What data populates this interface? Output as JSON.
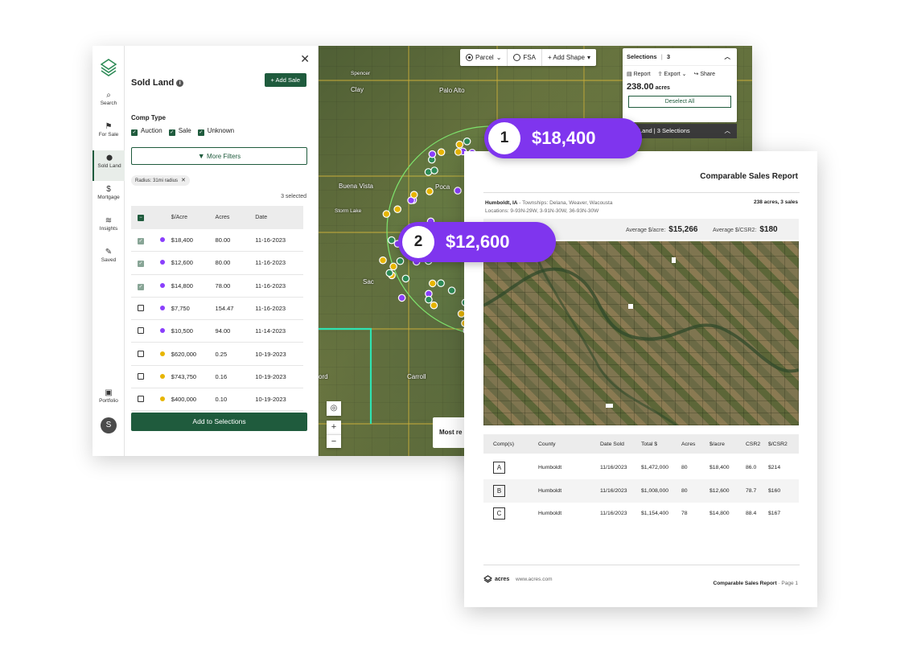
{
  "rail": {
    "items": [
      {
        "label": "Search",
        "icon": "search-icon",
        "glyph": "⌕"
      },
      {
        "label": "For Sale",
        "icon": "flag-icon",
        "glyph": "⚑"
      },
      {
        "label": "Sold Land",
        "icon": "map-pin-icon",
        "glyph": "⬤"
      },
      {
        "label": "Mortgage",
        "icon": "dollar-coin-icon",
        "glyph": "$"
      },
      {
        "label": "Insights",
        "icon": "layers-icon",
        "glyph": "≋"
      },
      {
        "label": "Saved",
        "icon": "pin-icon",
        "glyph": "✎"
      }
    ],
    "portfolio": {
      "label": "Portfolio",
      "glyph": "▣"
    },
    "avatar": "S"
  },
  "panel": {
    "title": "Sold Land",
    "add_sale": "+ Add Sale",
    "comp_type_label": "Comp Type",
    "comp_types": [
      {
        "label": "Auction",
        "checked": true
      },
      {
        "label": "Sale",
        "checked": true
      },
      {
        "label": "Unknown",
        "checked": true
      }
    ],
    "more_filters": "More Filters",
    "radius_chip": "Radius: 31mi radius",
    "selected_count": "3 selected",
    "columns": {
      "price": "$/Acre",
      "acres": "Acres",
      "date": "Date"
    },
    "rows": [
      {
        "checked": true,
        "dot": "#8a3ffc",
        "price": "$18,400",
        "acres": "80.00",
        "date": "11-16-2023"
      },
      {
        "checked": true,
        "dot": "#8a3ffc",
        "price": "$12,600",
        "acres": "80.00",
        "date": "11-16-2023"
      },
      {
        "checked": true,
        "dot": "#8a3ffc",
        "price": "$14,800",
        "acres": "78.00",
        "date": "11-16-2023"
      },
      {
        "checked": false,
        "dot": "#8a3ffc",
        "price": "$7,750",
        "acres": "154.47",
        "date": "11-16-2023"
      },
      {
        "checked": false,
        "dot": "#8a3ffc",
        "price": "$10,500",
        "acres": "94.00",
        "date": "11-14-2023"
      },
      {
        "checked": false,
        "dot": "#e7b500",
        "price": "$620,000",
        "acres": "0.25",
        "date": "10-19-2023"
      },
      {
        "checked": false,
        "dot": "#e7b500",
        "price": "$743,750",
        "acres": "0.16",
        "date": "10-19-2023"
      },
      {
        "checked": false,
        "dot": "#e7b500",
        "price": "$400,000",
        "acres": "0.10",
        "date": "10-19-2023"
      }
    ],
    "add_to_selections": "Add to Selections"
  },
  "map": {
    "toolbar": {
      "parcel": "Parcel",
      "fsa": "FSA",
      "add_shape": "+ Add Shape"
    },
    "selections": {
      "title": "Selections",
      "count": "3",
      "report": "Report",
      "export": "Export",
      "share": "Share",
      "acres_value": "238.00",
      "acres_unit": "acres",
      "deselect_all": "Deselect All",
      "sold_land_bar": "Land  |  3 Selections"
    },
    "towns": [
      {
        "name": "Spencer"
      },
      {
        "name": "Clay"
      },
      {
        "name": "Palo Alto"
      },
      {
        "name": "Buena Vista"
      },
      {
        "name": "Storm Lake"
      },
      {
        "name": "Poca"
      },
      {
        "name": "Sac"
      },
      {
        "name": "Carroll"
      },
      {
        "name": "ord"
      }
    ],
    "most_recent": "Most re",
    "zoom_in": "+",
    "zoom_out": "−"
  },
  "callouts": [
    {
      "num": "1",
      "amount": "$18,400"
    },
    {
      "num": "2",
      "amount": "$12,600"
    }
  ],
  "report": {
    "title": "Comparable Sales Report",
    "location": "Humboldt, IA",
    "townships": " - Townships: Delana, Weaver, Wacousta",
    "locations": "Locations: 9-93N-29W, 3-91N-30W, 36-93N-30W",
    "summary": "238 acres, 3 sales",
    "avg_acre_label": "Average $/acre:",
    "avg_acre_value": "$15,266",
    "avg_csr2_label": "Average $/CSR2:",
    "avg_csr2_value": "$180",
    "columns": [
      "Comp(s)",
      "County",
      "Date Sold",
      "Total $",
      "Acres",
      "$/acre",
      "CSR2",
      "$/CSR2"
    ],
    "rows": [
      {
        "comp": "A",
        "county": "Humboldt",
        "date": "11/16/2023",
        "total": "$1,472,000",
        "acres": "80",
        "per_acre": "$18,400",
        "csr2": "86.0",
        "per_csr2": "$214"
      },
      {
        "comp": "B",
        "county": "Humboldt",
        "date": "11/16/2023",
        "total": "$1,008,000",
        "acres": "80",
        "per_acre": "$12,600",
        "csr2": "78.7",
        "per_csr2": "$160"
      },
      {
        "comp": "C",
        "county": "Humboldt",
        "date": "11/16/2023",
        "total": "$1,154,400",
        "acres": "78",
        "per_acre": "$14,800",
        "csr2": "88.4",
        "per_csr2": "$167"
      }
    ],
    "logo_text": "acres",
    "url": "www.acres.com",
    "footer_title": "Comparable Sales Report",
    "footer_page": " · Page 1"
  },
  "colors": {
    "brand_green": "#1f5b3d",
    "callout_purple": "#7f35ee",
    "dot_purple": "#8a3ffc",
    "dot_yellow": "#e7b500",
    "dot_green": "#2e8b57"
  }
}
